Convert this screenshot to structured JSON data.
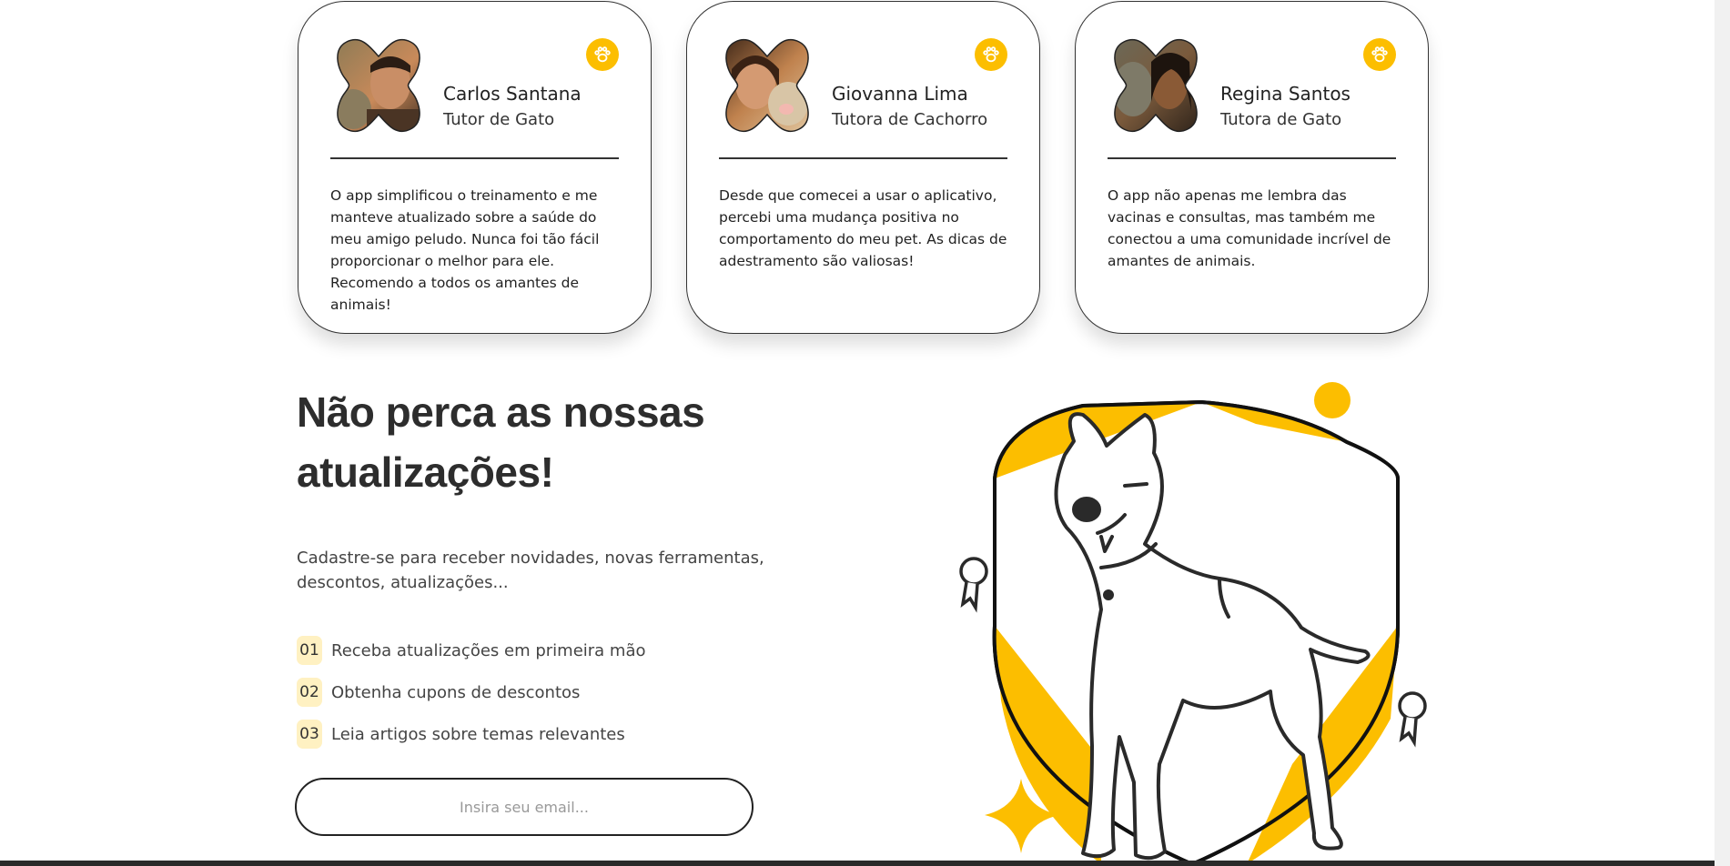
{
  "testimonials": [
    {
      "name": "Carlos Santana",
      "role": "Tutor de Gato",
      "quote": "O app simplificou o treinamento e me manteve atualizado sobre a saúde do meu amigo peludo. Nunca foi tão fácil proporcionar o melhor para ele. Recomendo a todos os amantes de animais!"
    },
    {
      "name": "Giovanna Lima",
      "role": "Tutora de Cachorro",
      "quote": "Desde que comecei a usar o aplicativo, percebi uma mudança positiva no comportamento do meu pet. As dicas de adestramento são valiosas!"
    },
    {
      "name": "Regina Santos",
      "role": "Tutora de Gato",
      "quote": "O app não apenas me lembra das vacinas e consultas, mas também me conectou a uma comunidade incrível de amantes de animais."
    }
  ],
  "newsletter": {
    "title": "Não perca as nossas atualizações!",
    "subtitle": "Cadastre-se para receber novidades, novas ferramentas, descontos, atualizações...",
    "benefits": [
      {
        "num": "01",
        "text": "Receba atualizações em primeira mão"
      },
      {
        "num": "02",
        "text": "Obtenha cupons de descontos"
      },
      {
        "num": "03",
        "text": "Leia artigos sobre temas relevantes"
      }
    ],
    "email_placeholder": "Insira seu email..."
  },
  "colors": {
    "accent": "#fcbe00",
    "badge_bg": "#fff1c2",
    "text_dark": "#2d2d2d"
  },
  "icons": {
    "card_badge": "paw-icon"
  }
}
